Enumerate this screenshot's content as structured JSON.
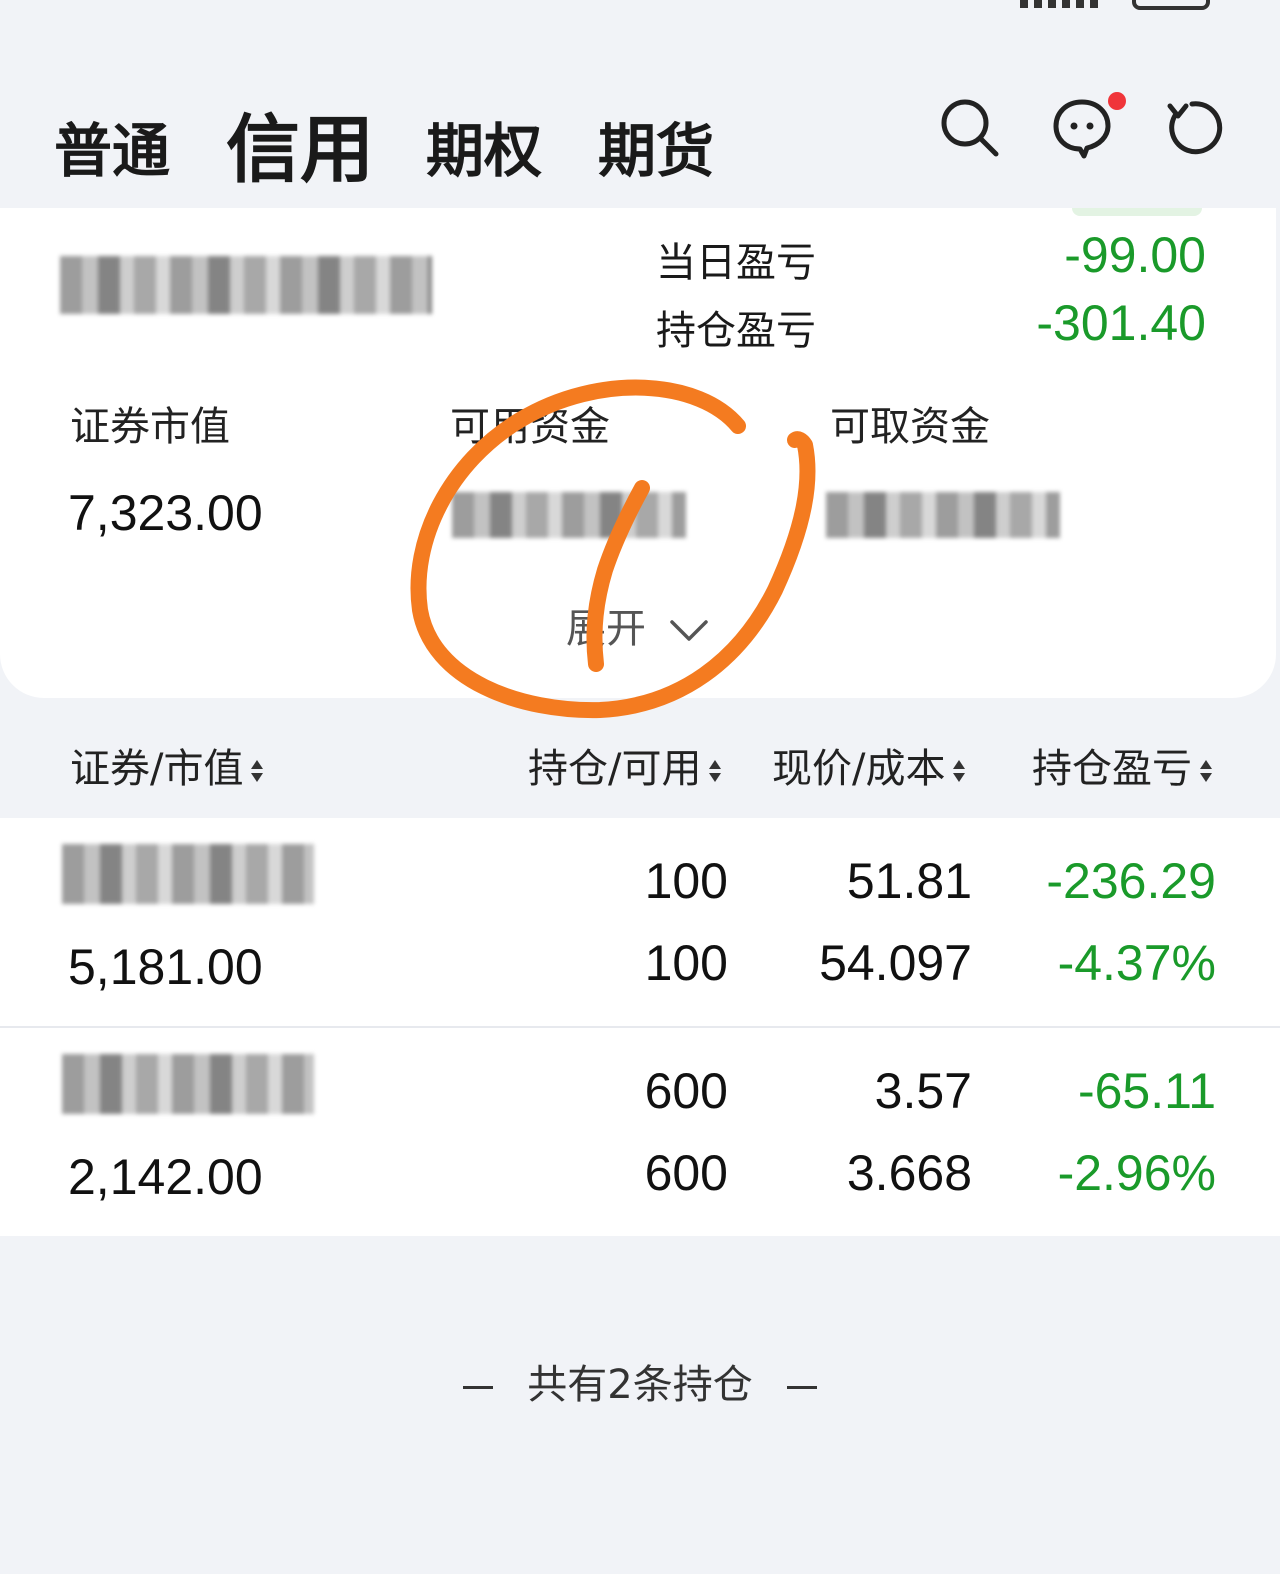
{
  "nav": {
    "tabs": [
      {
        "label": "普通"
      },
      {
        "label": "信用"
      },
      {
        "label": "期权"
      },
      {
        "label": "期货"
      }
    ],
    "icons": [
      "search-icon",
      "message-icon",
      "refresh-icon"
    ]
  },
  "account": {
    "daily_pnl_label": "当日盈亏",
    "daily_pnl_value": "-99.00",
    "position_pnl_label": "持仓盈亏",
    "position_pnl_value": "-301.40",
    "market_value_label": "证券市值",
    "market_value": "7,323.00",
    "available_funds_label": "可用资金",
    "withdrawable_label": "可取资金",
    "expand_label": "展开"
  },
  "table": {
    "headers": [
      "证券/市值",
      "持仓/可用",
      "现价/成本",
      "持仓盈亏"
    ],
    "rows": [
      {
        "market_value": "5,181.00",
        "holding": "100",
        "available": "100",
        "price": "51.81",
        "cost": "54.097",
        "pnl": "-236.29",
        "pnl_pct": "-4.37%"
      },
      {
        "market_value": "2,142.00",
        "holding": "600",
        "available": "600",
        "price": "3.57",
        "cost": "3.668",
        "pnl": "-65.11",
        "pnl_pct": "-2.96%"
      }
    ]
  },
  "footer": {
    "summary": "共有2条持仓"
  },
  "colors": {
    "loss_green": "#1a9a2a",
    "annotation_orange": "#f47b20",
    "badge_red": "#f0353a",
    "background": "#f1f3f7"
  }
}
